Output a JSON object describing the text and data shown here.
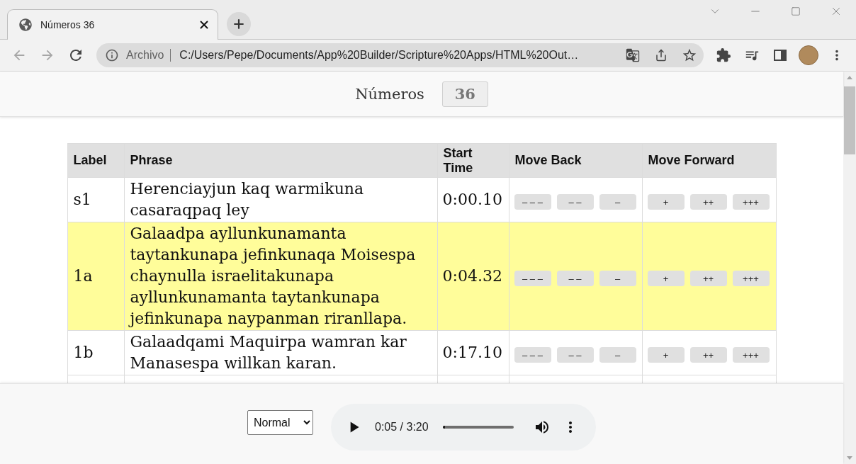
{
  "browser": {
    "tabs": [
      {
        "title": "Números 36",
        "selected": true
      }
    ],
    "address_bar": {
      "security_label": "Archivo",
      "url": "C:/Users/Pepe/Documents/App%20Builder/Scripture%20Apps/HTML%20Out…"
    }
  },
  "page_header": {
    "book": "Números",
    "chapter": "36"
  },
  "table": {
    "columns": [
      "Label",
      "Phrase",
      "Start Time",
      "Move Back",
      "Move Forward"
    ],
    "rows": [
      {
        "label": "s1",
        "phrase": "Herenciayjun kaq warmikuna casaraqpaq ley",
        "start_time": "0:00.10",
        "selected": false,
        "move_back": [
          "– – –",
          "– –",
          "–"
        ],
        "move_forward": [
          "+",
          "++",
          "+++"
        ]
      },
      {
        "label": "1a",
        "phrase": "Galaadpa ayllunkunamanta taytankunapa jefinkunaqa Moisespa chaynulla israelitakunapa ayllunkunamanta taytankunapa jefinkunapa naypanman riranllapa.",
        "start_time": "0:04.32",
        "selected": true,
        "move_back": [
          "– – –",
          "– –",
          "–"
        ],
        "move_forward": [
          "+",
          "++",
          "+++"
        ]
      },
      {
        "label": "1b",
        "phrase": "Galaadqami Maquirpa wamran kar Manasespa willkan karan.",
        "start_time": "0:17.10",
        "selected": false,
        "move_back": [
          "– – –",
          "– –",
          "–"
        ],
        "move_forward": [
          "+",
          "++",
          "+++"
        ]
      }
    ]
  },
  "player": {
    "speed": "Normal",
    "time": "0:05 / 3:20",
    "level": 0.03
  }
}
